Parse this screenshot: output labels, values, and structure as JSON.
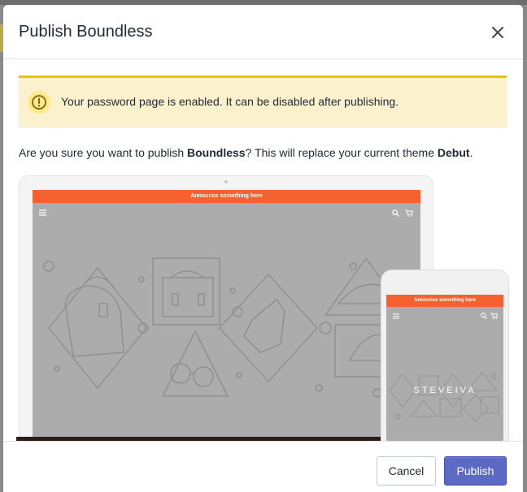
{
  "modal": {
    "title": "Publish Boundless",
    "close_icon": "close-icon"
  },
  "banner": {
    "icon": "warning-icon",
    "text": "Your password page is enabled. It can be disabled after publishing.",
    "color": "#fcf1cd",
    "accent": "#eec200"
  },
  "confirm": {
    "prefix": "Are you sure you want to publish ",
    "theme_new": "Boundless",
    "middle": "? This will replace your current theme ",
    "theme_current": "Debut",
    "suffix": "."
  },
  "preview": {
    "desktop_announcement": "Announce something here",
    "mobile_announcement": "Announce something here",
    "mobile_brand": "STEVEIVA",
    "menu_icon": "hamburger-icon",
    "search_icon": "search-icon",
    "cart_icon": "cart-icon",
    "announcement_color": "#f5622f"
  },
  "footer": {
    "cancel_label": "Cancel",
    "publish_label": "Publish",
    "primary_color": "#5c6ac4"
  }
}
